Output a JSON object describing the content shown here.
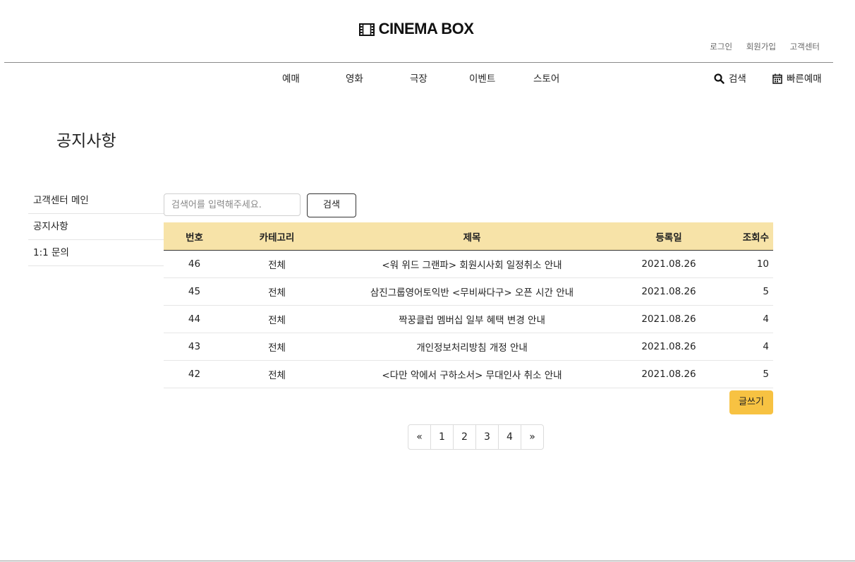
{
  "header": {
    "logo_text": "CINEMA BOX",
    "top_links": [
      "로그인",
      "회원가입",
      "고객센터"
    ],
    "main_nav": [
      "예매",
      "영화",
      "극장",
      "이벤트",
      "스토어"
    ],
    "search_label": "검색",
    "quick_booking_label": "빠른예매"
  },
  "page": {
    "title": "공지사항"
  },
  "sidebar": {
    "items": [
      {
        "label": "고객센터 메인"
      },
      {
        "label": "공지사항"
      },
      {
        "label": "1:1 문의"
      }
    ]
  },
  "search": {
    "placeholder": "검색어를 입력해주세요.",
    "button_label": "검색"
  },
  "table": {
    "headers": [
      "번호",
      "카테고리",
      "제목",
      "등록일",
      "조회수"
    ],
    "rows": [
      {
        "num": "46",
        "category": "전체",
        "title": "<워 위드 그랜파> 회원시사회 일정취소 안내",
        "date": "2021.08.26",
        "views": "10"
      },
      {
        "num": "45",
        "category": "전체",
        "title": "삼진그룹영어토익반 <무비싸다구> 오픈 시간 안내",
        "date": "2021.08.26",
        "views": "5"
      },
      {
        "num": "44",
        "category": "전체",
        "title": "짝꿍클럽 멤버십 일부 혜택 변경 안내",
        "date": "2021.08.26",
        "views": "4"
      },
      {
        "num": "43",
        "category": "전체",
        "title": "개인정보처리방침 개정 안내",
        "date": "2021.08.26",
        "views": "4"
      },
      {
        "num": "42",
        "category": "전체",
        "title": "<다만 악에서 구하소서> 무대인사 취소 안내",
        "date": "2021.08.26",
        "views": "5"
      }
    ]
  },
  "write_button_label": "글쓰기",
  "pagination": {
    "prev": "«",
    "pages": [
      "1",
      "2",
      "3",
      "4"
    ],
    "next": "»"
  },
  "colors": {
    "accent": "#f7c242",
    "table_header_bg": "#f7e3a8"
  },
  "icons": {
    "logo": "film-icon",
    "search": "search-icon",
    "quick_booking": "calendar-icon"
  }
}
